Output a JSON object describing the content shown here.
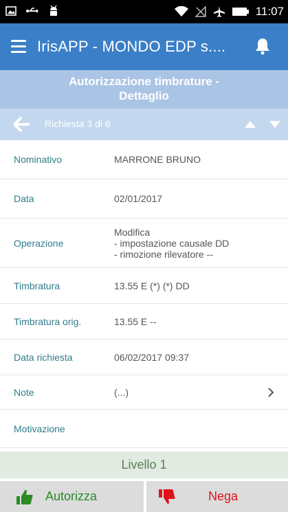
{
  "status_bar": {
    "time": "11:07",
    "icons": [
      "gallery-icon",
      "usb-icon",
      "android-icon",
      "wifi-icon",
      "no-signal-icon",
      "airplane-icon",
      "battery-icon"
    ]
  },
  "app_bar": {
    "title": "IrisAPP - MONDO EDP s....",
    "menu_icon": "hamburger-menu-icon",
    "notification_icon": "bell-icon"
  },
  "header": {
    "title_line1": "Autorizzazione timbrature -",
    "title_line2": "Dettaglio"
  },
  "nav": {
    "label": "Richiesta 3 di 6",
    "back_icon": "arrow-left-icon",
    "prev_icon": "triangle-up-icon",
    "next_icon": "triangle-down-icon"
  },
  "fields": [
    {
      "label": "Nominativo",
      "value": [
        "MARRONE BRUNO"
      ]
    },
    {
      "label": "Data",
      "value": [
        "02/01/2017"
      ]
    },
    {
      "label": "Operazione",
      "value": [
        "Modifica",
        "- impostazione causale DD",
        "- rimozione rilevatore --"
      ]
    },
    {
      "label": "Timbratura",
      "value": [
        "13.55 E (*)  (*) DD"
      ]
    },
    {
      "label": "Timbratura orig.",
      "value": [
        "13.55 E --"
      ]
    },
    {
      "label": "Data richiesta",
      "value": [
        "06/02/2017 09:37"
      ]
    },
    {
      "label": "Note",
      "value": [
        "(...)"
      ]
    },
    {
      "label": "Motivazione",
      "value": [
        ""
      ]
    }
  ],
  "level": "Livello 1",
  "actions": {
    "approve_label": "Autorizza",
    "deny_label": "Nega"
  },
  "colors": {
    "app_bar": "#3a7fc8",
    "header": "#a9c4e4",
    "nav_bar": "#c3d7ee",
    "label": "#2e7d8c",
    "approve": "#2a8a26",
    "deny": "#e0111a"
  }
}
